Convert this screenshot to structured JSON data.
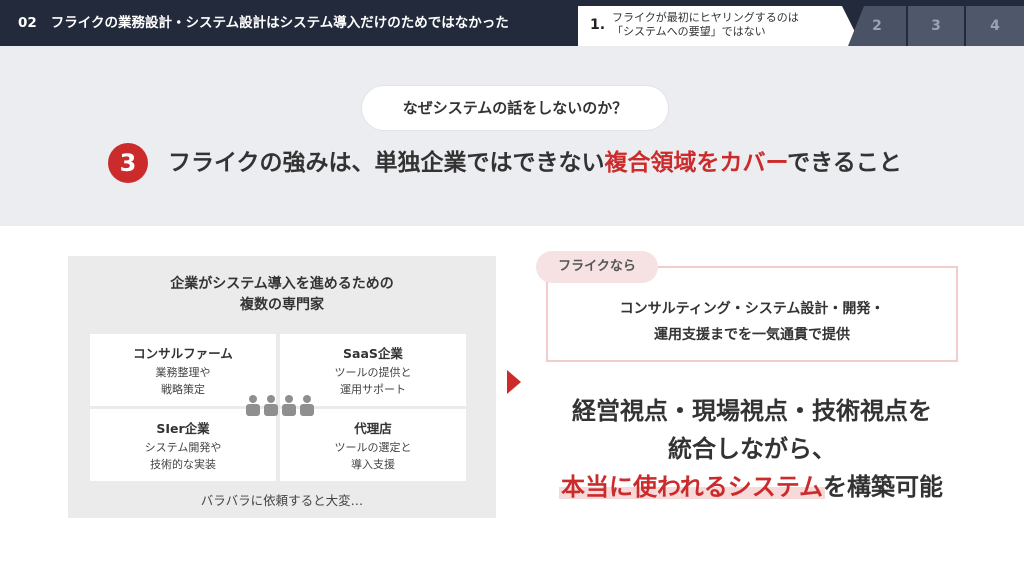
{
  "header": {
    "section_number": "02",
    "title": "フライクの業務設計・システム設計はシステム導入だけのためではなかった",
    "steps": [
      {
        "number": "1.",
        "label_line1": "フライクが最初にヒヤリングするのは",
        "label_line2": "「システムへの要望」ではない",
        "active": true
      },
      {
        "number": "2",
        "active": false
      },
      {
        "number": "3",
        "active": false
      },
      {
        "number": "4",
        "active": false
      }
    ]
  },
  "band": {
    "question": "なぜシステムの話をしないのか？",
    "point_number": "3",
    "headline_pre": "フライクの強みは、単独企業ではできない",
    "headline_red": "複合領域をカバー",
    "headline_post": "できること"
  },
  "panel": {
    "title_line1": "企業がシステム導入を進めるための",
    "title_line2": "複数の専門家",
    "cards": [
      {
        "heading": "コンサルファーム",
        "line1": "業務整理や",
        "line2": "戦略策定"
      },
      {
        "heading": "SaaS企業",
        "line1": "ツールの提供と",
        "line2": "運用サポート"
      },
      {
        "heading": "SIer企業",
        "line1": "システム開発や",
        "line2": "技術的な実装"
      },
      {
        "heading": "代理店",
        "line1": "ツールの選定と",
        "line2": "導入支援"
      }
    ],
    "footer": "バラバラに依頼すると大変…"
  },
  "right": {
    "tag": "フライクなら",
    "callout_line1": "コンサルティング・システム設計・開発・",
    "callout_line2": "運用支援までを一気通貫で提供",
    "big_line1": "経営視点・現場視点・技術視点を",
    "big_line2": "統合しながら、",
    "big_line3_highlight": "本当に使われるシステム",
    "big_line3_post": "を構築可能"
  },
  "colors": {
    "accent_red": "#cc2b2b",
    "header_bg": "#232a3c",
    "band_bg": "#ecedf1"
  },
  "icons": {
    "people": "people-group-icon",
    "arrow": "triangle-right-icon"
  }
}
